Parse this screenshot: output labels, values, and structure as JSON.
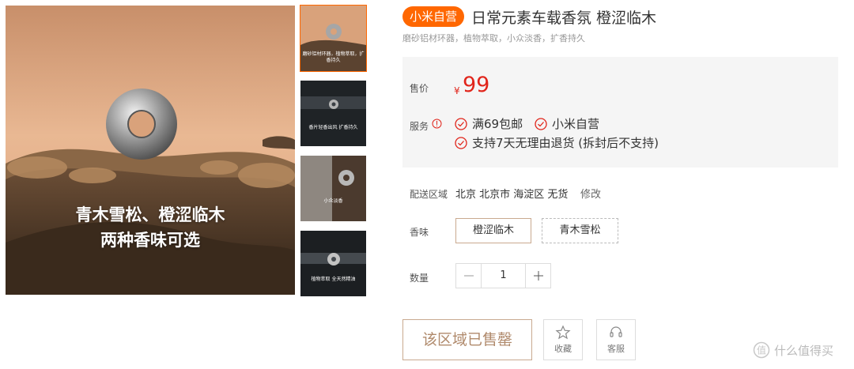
{
  "main_image": {
    "caption_line1": "青木雪松、橙涩临木",
    "caption_line2": "两种香味可选"
  },
  "thumbnails": [
    {
      "caption": "磨砂铝材环器，植物萃取，扩香持久",
      "active": true
    },
    {
      "caption": "香片轻香出风 扩香持久",
      "active": false
    },
    {
      "caption": "小众淡香",
      "active": false
    },
    {
      "caption": "植物萃取 全天然精油",
      "active": false
    }
  ],
  "product": {
    "badge": "小米自营",
    "title": "日常元素车载香氛 橙涩临木",
    "subtitle": "磨砂铝材环器，植物萃取，小众淡香，扩香持久"
  },
  "price": {
    "label": "售价",
    "currency": "¥",
    "value": "99"
  },
  "service": {
    "label": "服务",
    "items": [
      "满69包邮",
      "小米自营",
      "支持7天无理由退货 (拆封后不支持)"
    ]
  },
  "delivery": {
    "label": "配送区域",
    "value": "北京 北京市 海淀区 无货",
    "edit": "修改"
  },
  "scent": {
    "label": "香味",
    "options": [
      "橙涩临木",
      "青木雪松"
    ],
    "selected": "橙涩临木"
  },
  "quantity": {
    "label": "数量",
    "value": "1"
  },
  "actions": {
    "soldout": "该区域已售罄",
    "favorite": "收藏",
    "customer_service": "客服"
  },
  "watermark": "什么值得买",
  "colors": {
    "accent": "#ff6700",
    "price": "#e1251b",
    "service_check": "#e1251b",
    "soldout_text": "#b08a6c"
  }
}
